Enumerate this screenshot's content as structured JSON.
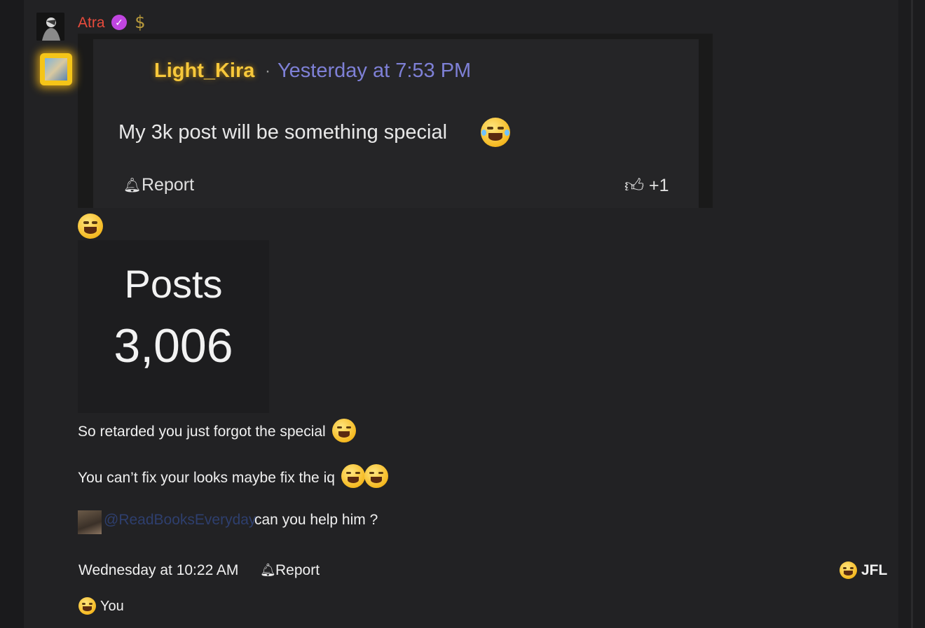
{
  "post": {
    "author": "Atra",
    "badges": [
      "verified-icon",
      "dollar-icon"
    ],
    "quote": {
      "author": "Light_Kira",
      "separator": "·",
      "time": "Yesterday at 7:53 PM",
      "text": "My 3k post will be something special",
      "report_label": "Report",
      "like_count": "+1"
    },
    "stats_image": {
      "label": "Posts",
      "value": "3,006"
    },
    "lines": [
      "So retarded you just forgot the special",
      "You can’t fix your looks maybe fix the iq"
    ],
    "mention": {
      "handle": "@ReadBooksEveryday",
      "text": "can you help him ?"
    },
    "footer": {
      "time": "Wednesday at 10:22 AM",
      "report_label": "Report",
      "reaction_label": "JFL",
      "reactor": "You"
    }
  },
  "colors": {
    "author": "#e84b3c",
    "quote_author": "#f7c83b",
    "quote_time": "#7e80d6",
    "mention": "#2e3f6e",
    "verified": "#c045e0"
  }
}
